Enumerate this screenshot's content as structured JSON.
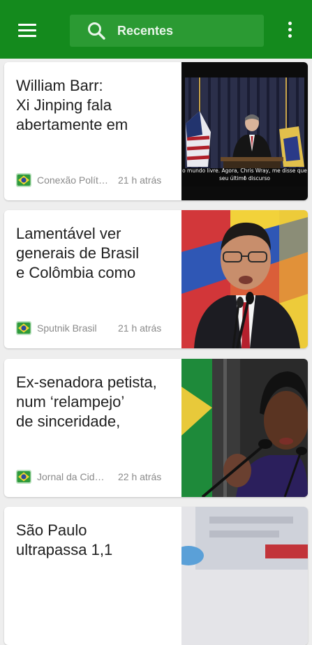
{
  "appbar": {
    "background": "#148a1d",
    "menu_icon": "hamburger-menu-icon",
    "search": {
      "icon": "search-icon",
      "label": "Recentes"
    },
    "more_icon": "more-vert-icon"
  },
  "news": [
    {
      "title": "William Barr:\nXi Jinping fala\nabertamente em",
      "source": "Conexão Política",
      "time": "21 h atrás",
      "source_icon": "brazil-flag-icon",
      "caption_1": "o mundo livre. Agora, Chris Wray, me disse que f",
      "caption_2": "seu último discurso"
    },
    {
      "title": "Lamentável ver\ngenerais de Brasil\ne Colômbia como",
      "source": "Sputnik Brasil",
      "time": "21 h atrás",
      "source_icon": "brazil-flag-icon"
    },
    {
      "title": "Ex-senadora petista,\nnum ‘relampejo’\nde sinceridade,",
      "source": "Jornal da Cidade",
      "time": "22 h atrás",
      "source_icon": "brazil-flag-icon"
    },
    {
      "title": "São Paulo\nultrapassa 1,1",
      "source": "",
      "time": "",
      "source_icon": "brazil-flag-icon"
    }
  ]
}
